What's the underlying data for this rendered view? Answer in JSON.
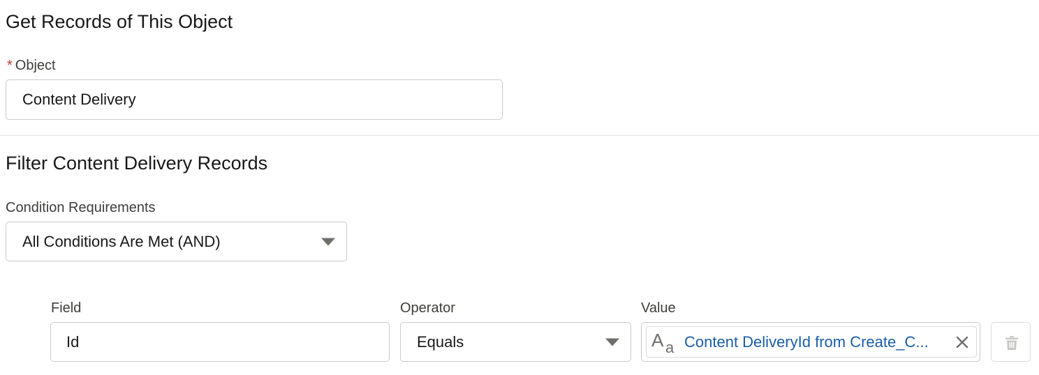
{
  "object_section": {
    "title": "Get Records of This Object",
    "object_label": "Object",
    "required_mark": "*",
    "object_value": "Content Delivery"
  },
  "filter_section": {
    "title": "Filter Content Delivery Records",
    "condition_label": "Condition Requirements",
    "condition_value": "All Conditions Are Met (AND)"
  },
  "condition_row": {
    "field_label": "Field",
    "field_value": "Id",
    "operator_label": "Operator",
    "operator_value": "Equals",
    "value_label": "Value",
    "value_resource": "Content DeliveryId from Create_C...",
    "value_icon": "text-type-icon",
    "remove_icon": "close-icon",
    "delete_icon": "trash-icon"
  },
  "colors": {
    "required": "#c23934",
    "link": "#1b5ea8",
    "border": "#c9c9c9",
    "icon": "#706e6b"
  }
}
